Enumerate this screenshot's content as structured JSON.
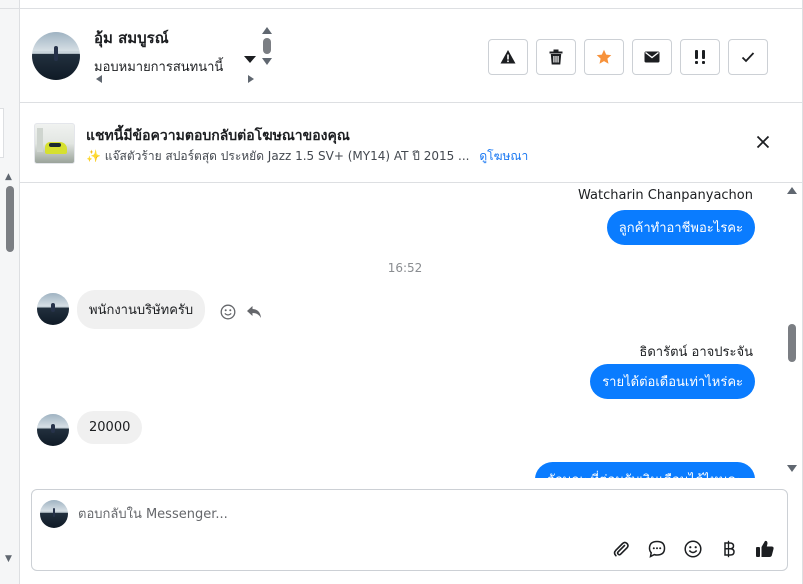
{
  "header": {
    "contact_name": "อุ้ม สมบูรณ์",
    "assign_label": "มอบหมายการสนทนานี้",
    "actions": [
      {
        "name": "report-spam-button",
        "icon": "warning-icon"
      },
      {
        "name": "delete-button",
        "icon": "trash-icon"
      },
      {
        "name": "star-button",
        "icon": "star-icon"
      },
      {
        "name": "mark-unread-button",
        "icon": "envelope-icon"
      },
      {
        "name": "follow-up-button",
        "icon": "double-exclamation-icon"
      },
      {
        "name": "mark-done-button",
        "icon": "check-icon"
      }
    ]
  },
  "ad_banner": {
    "title": "แชทนี้มีข้อความตอบกลับต่อโฆษณาของคุณ",
    "subtitle": "แจ๊สตัวร้าย สปอร์ตสุด ประหยัด  Jazz 1.5 SV+ (MY14) AT ปี 2015 ...",
    "link": "ดูโฆษณา"
  },
  "conversation": {
    "sender_1": "Watcharin Chanpanyachon",
    "msg_out_1": "ลูกค้าทำอาชีพอะไรคะ",
    "time_separator": "16:52",
    "msg_in_1": "พนักงานบริษัทครับ",
    "sender_2": "ธิดารัตน์ อาจประจัน",
    "msg_out_2": "รายได้ต่อเดือนเท่าไหร่คะ",
    "msg_in_2": "20000",
    "msg_out_3": "ลักษณะที่ต่อนรับเงินเดือนได้ไหมคะ"
  },
  "reply": {
    "placeholder": "ตอบกลับใน Messenger...",
    "tools": [
      "paperclip-icon",
      "chat-bubble-icon",
      "emoji-icon",
      "baht-icon",
      "thumbs-up-icon"
    ]
  },
  "colors": {
    "accent": "#0a7cff",
    "star": "#f7923b",
    "link": "#1877f2"
  }
}
